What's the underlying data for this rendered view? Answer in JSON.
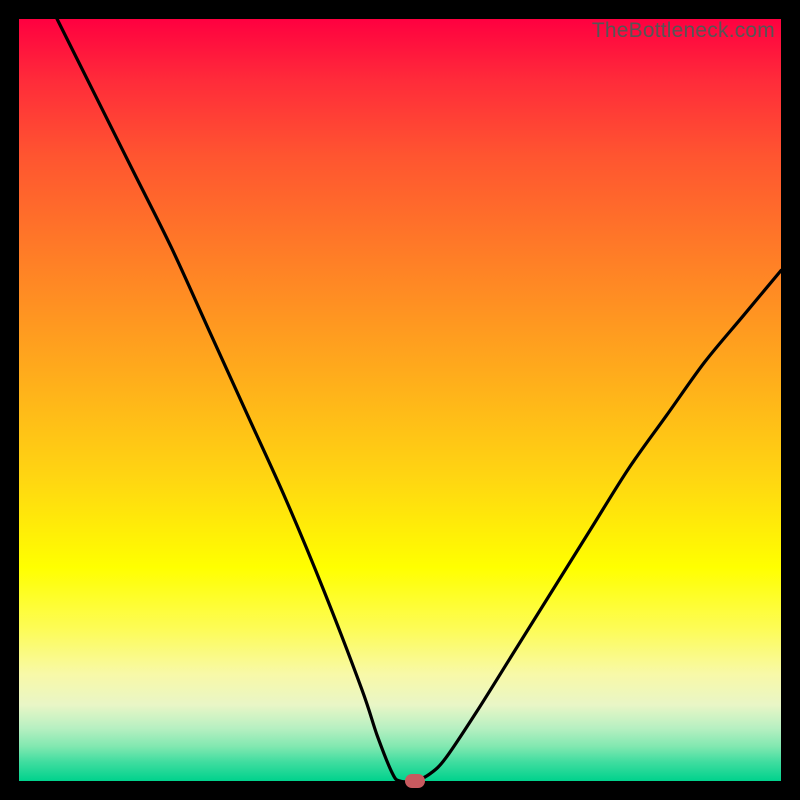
{
  "watermark": "TheBottleneck.com",
  "colors": {
    "frame": "#000000",
    "curve": "#000000",
    "marker": "#c85a5f",
    "gradient_top": "#ff0040",
    "gradient_bottom": "#00d28d"
  },
  "chart_data": {
    "type": "line",
    "title": "",
    "xlabel": "",
    "ylabel": "",
    "xlim": [
      0,
      100
    ],
    "ylim": [
      0,
      100
    ],
    "series": [
      {
        "name": "bottleneck-curve",
        "x": [
          0,
          5,
          10,
          15,
          20,
          25,
          30,
          35,
          40,
          45,
          47,
          49,
          50,
          52,
          54,
          56,
          60,
          65,
          70,
          75,
          80,
          85,
          90,
          95,
          100
        ],
        "values": [
          110,
          100,
          90,
          80,
          70,
          59,
          48,
          37,
          25,
          12,
          6,
          1,
          0,
          0,
          1,
          3,
          9,
          17,
          25,
          33,
          41,
          48,
          55,
          61,
          67
        ]
      }
    ],
    "marker": {
      "x": 52,
      "y": 0
    },
    "annotations": []
  }
}
